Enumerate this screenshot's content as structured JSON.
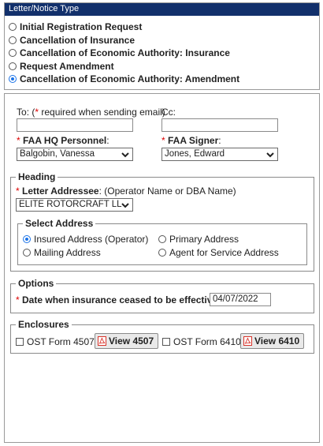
{
  "letter_type": {
    "header": "Letter/Notice Type",
    "options": [
      {
        "label": "Initial Registration Request",
        "selected": false
      },
      {
        "label": "Cancellation of Insurance",
        "selected": false
      },
      {
        "label": "Cancellation of Economic Authority: Insurance",
        "selected": false
      },
      {
        "label": "Request Amendment",
        "selected": false
      },
      {
        "label": "Cancellation of Economic Authority: Amendment",
        "selected": true
      }
    ]
  },
  "recipients": {
    "to_label": "To",
    "to_colon": ": (",
    "to_star": "*",
    "to_note": " required when sending email)",
    "cc_label": "Cc:",
    "to_value": "",
    "cc_value": ""
  },
  "personnel": {
    "star": "*",
    "hq_label": "FAA HQ Personnel",
    "hq_value": "Balgobin, Vanessa",
    "signer_label": "FAA Signer",
    "signer_value": "Jones, Edward",
    "colon": ":"
  },
  "heading": {
    "legend": "Heading",
    "addressee_label": "Letter Addressee",
    "addressee_note": ": (Operator Name or DBA Name)",
    "addressee_value": "ELITE ROTORCRAFT LL",
    "select_address": {
      "legend": "Select Address",
      "options": [
        {
          "label": "Insured Address (Operator)",
          "selected": true
        },
        {
          "label": "Primary Address",
          "selected": false
        },
        {
          "label": "Mailing Address",
          "selected": false
        },
        {
          "label": "Agent for Service Address",
          "selected": false
        }
      ]
    }
  },
  "options": {
    "legend": "Options",
    "date_label": "Date when insurance ceased to be effective",
    "date_value": "04/07/2022"
  },
  "enclosures": {
    "legend": "Enclosures",
    "items": [
      {
        "label": "OST Form 4507",
        "button": "View 4507",
        "checked": false
      },
      {
        "label": "OST Form 6410",
        "button": "View 6410",
        "checked": false
      }
    ]
  },
  "colors": {
    "header_bg": "#12306b",
    "required": "#dd0000",
    "radio_selected": "#1a73e8",
    "pdf_icon": "#d9342b"
  }
}
